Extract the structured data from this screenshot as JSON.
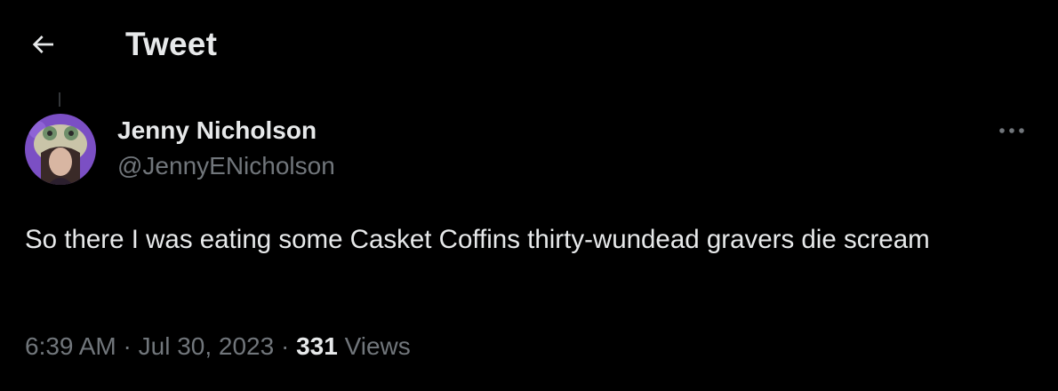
{
  "header": {
    "back_icon": "arrow-left-icon",
    "title": "Tweet"
  },
  "author": {
    "name": "Jenny Nicholson",
    "handle": "@JennyENicholson",
    "avatar_bg": "#7b4fc4"
  },
  "tweet": {
    "text": "So there I was eating some Casket Coffins thirty-wundead gravers die scream",
    "time": "6:39 AM",
    "separator": " · ",
    "date": "Jul 30, 2023",
    "views_count": "331",
    "views_label": "Views"
  },
  "actions": {
    "more_icon": "more-horizontal-icon"
  },
  "colors": {
    "background": "#000000",
    "primary_text": "#e7e9ea",
    "secondary_text": "#71767b",
    "thread_line": "#333639"
  }
}
